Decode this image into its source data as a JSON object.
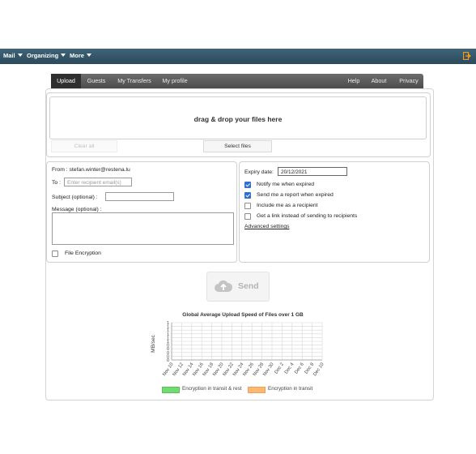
{
  "topbar": {
    "menus": [
      "Mail",
      "Organizing",
      "More"
    ],
    "exit_icon": "exit-icon"
  },
  "tabs": {
    "left": [
      "Upload",
      "Guests",
      "My Transfers",
      "My profile"
    ],
    "right": [
      "Help",
      "About",
      "Privacy"
    ],
    "active": "Upload"
  },
  "upload": {
    "drop_text": "drag & drop your files here",
    "clear_label": "Clear all",
    "select_label": "Select files"
  },
  "form": {
    "from_text": "From : stefan.winter@restena.lu",
    "to_label": "To :",
    "to_placeholder": "Enter recipient email(s)",
    "subject_label": "Subject (optional) :",
    "message_label": "Message (optional) :",
    "file_encryption_label": "File Encryption"
  },
  "options": {
    "expiry_label": "Expiry date:",
    "expiry_value": "20/12/2021",
    "notify_label": "Notify me when expired",
    "report_label": "Send me a report when expired",
    "include_label": "Include me as a recipient",
    "getlink_label": "Get a link instead of sending to recipients",
    "advanced_label": "Advanced settings"
  },
  "send": {
    "label": "Send"
  },
  "colors": {
    "topbar": "#2f4e61",
    "checkbox": "#2f6fd1",
    "legend_green": "#6fdc6f",
    "legend_orange": "#ffb870"
  },
  "chart_data": {
    "type": "line",
    "title": "Global Average Upload Speed of Files over 1 GB",
    "ylabel": "MB/sec",
    "xlabel": "",
    "x": [
      "Nov 10",
      "Nov 12",
      "Nov 14",
      "Nov 16",
      "Nov 18",
      "Nov 20",
      "Nov 22",
      "Nov 24",
      "Nov 26",
      "Nov 28",
      "Nov 30",
      "Dec 2",
      "Dec 4",
      "Dec 6",
      "Dec 8",
      "Dec 10"
    ],
    "yticks": [
      0,
      0,
      0,
      0,
      0,
      1,
      1,
      1,
      1,
      1,
      1
    ],
    "ylim": [
      0,
      1
    ],
    "series": [
      {
        "name": "Encryption in transit & rest",
        "color": "#6fdc6f",
        "values": []
      },
      {
        "name": "Encryption in transit",
        "color": "#ffb870",
        "values": []
      }
    ],
    "grid": true,
    "legend": "bottom"
  }
}
